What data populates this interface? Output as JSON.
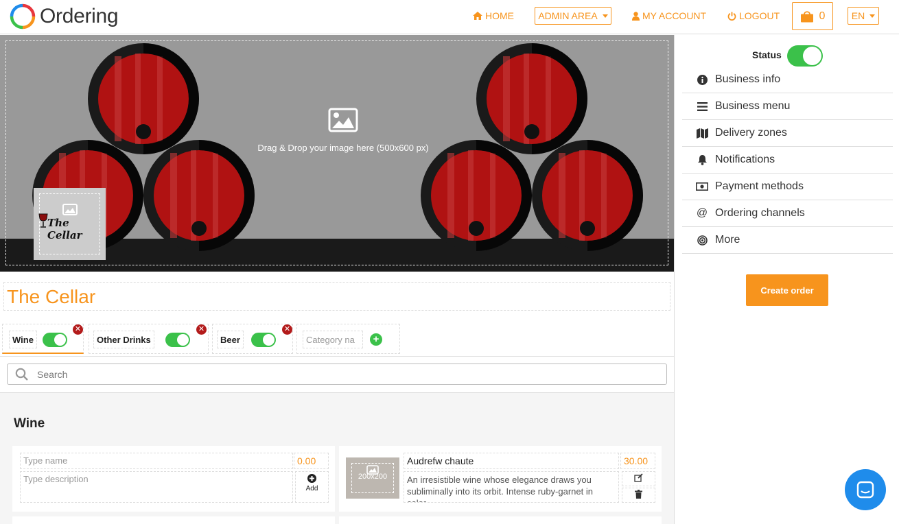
{
  "app": {
    "name": "Ordering"
  },
  "nav": {
    "home": "HOME",
    "admin_area": "ADMIN AREA",
    "my_account": "MY ACCOUNT",
    "logout": "LOGOUT",
    "cart_count": "0",
    "language": "EN"
  },
  "cover": {
    "drop_text": "Drag & Drop your image here (500x600 px)",
    "logo_text": "The Cellar"
  },
  "business": {
    "name": "The Cellar"
  },
  "categories": [
    {
      "label": "Wine",
      "enabled": true,
      "active": true
    },
    {
      "label": "Other Drinks",
      "enabled": true,
      "active": false
    },
    {
      "label": "Beer",
      "enabled": true,
      "active": false
    }
  ],
  "new_category_placeholder": "Category na",
  "search": {
    "placeholder": "Search"
  },
  "menu": {
    "section_title": "Wine",
    "new_product": {
      "name_placeholder": "Type name",
      "description_placeholder": "Type description",
      "price": "0.00",
      "add_label": "Add"
    },
    "products": [
      {
        "name": "Audrefw chaute",
        "price": "30.00",
        "thumb_size": "200x200",
        "description": "An irresistible wine whose elegance draws you subliminally into its orbit. Intense ruby-garnet in color,"
      }
    ]
  },
  "sidebar": {
    "status_label": "Status",
    "status_on": true,
    "items": [
      {
        "label": "Business info",
        "icon": "info-icon"
      },
      {
        "label": "Business menu",
        "icon": "bars-icon"
      },
      {
        "label": "Delivery zones",
        "icon": "map-icon"
      },
      {
        "label": "Notifications",
        "icon": "bell-icon"
      },
      {
        "label": "Payment methods",
        "icon": "money-icon"
      },
      {
        "label": "Ordering channels",
        "icon": "at-icon"
      },
      {
        "label": "More",
        "icon": "bullseye-icon"
      }
    ],
    "create_order": "Create order"
  },
  "colors": {
    "accent": "#f7941d",
    "toggle_on": "#3bc14a",
    "remove": "#b31b1b",
    "chat": "#1f8ceb"
  }
}
